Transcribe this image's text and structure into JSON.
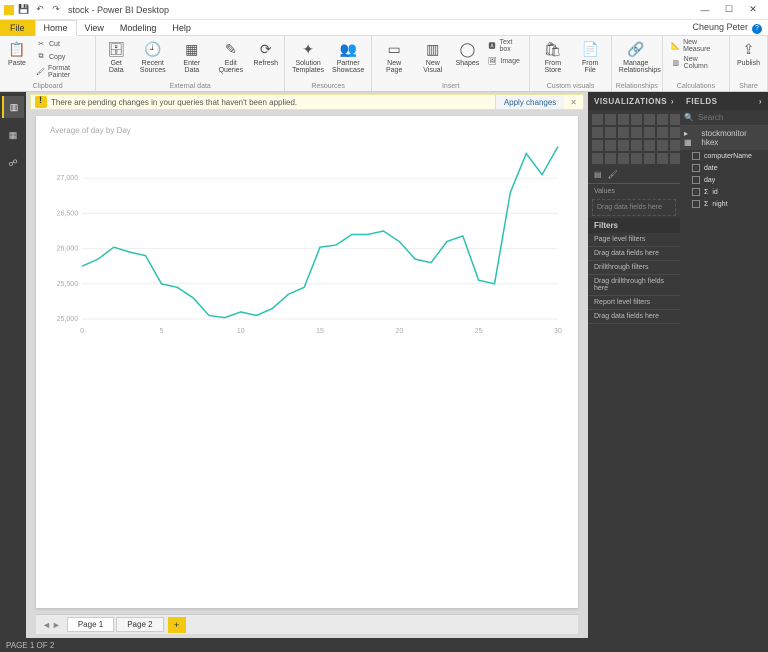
{
  "titlebar": {
    "title": "stock - Power BI Desktop"
  },
  "menu": {
    "file": "File",
    "tabs": [
      "Home",
      "View",
      "Modeling",
      "Help"
    ],
    "active": "Home",
    "user": "Cheung Peter"
  },
  "ribbon": {
    "clipboard": {
      "paste": "Paste",
      "cut": "Cut",
      "copy": "Copy",
      "format": "Format Painter",
      "group": "Clipboard"
    },
    "external": {
      "get": "Get Data",
      "recent": "Recent Sources",
      "enter": "Enter Data",
      "edit": "Edit Queries",
      "refresh": "Refresh",
      "group": "External data"
    },
    "resources": {
      "solution": "Solution Templates",
      "partner": "Partner Showcase",
      "group": "Resources"
    },
    "insert": {
      "newpage": "New Page",
      "newvisual": "New Visual",
      "shapes": "Shapes",
      "textbox": "Text box",
      "image": "Image",
      "group": "Insert"
    },
    "custom": {
      "store": "From Store",
      "file": "From File",
      "group": "Custom visuals"
    },
    "rel": {
      "manage": "Manage Relationships",
      "group": "Relationships"
    },
    "calc": {
      "measure": "New Measure",
      "column": "New Column",
      "group": "Calculations"
    },
    "share": {
      "publish": "Publish",
      "group": "Share"
    }
  },
  "warning": {
    "text": "There are pending changes in your queries that haven't been applied.",
    "apply": "Apply changes"
  },
  "pages": {
    "page1": "Page 1",
    "page2": "Page 2",
    "status": "PAGE 1 OF 2"
  },
  "viz": {
    "header": "Visualizations",
    "values": "Values",
    "drag": "Drag data fields here",
    "filters": "Filters",
    "pagefilters": "Page level filters",
    "dragfilters": "Drag data fields here",
    "drill": "Drillthrough filters",
    "dragdrill": "Drag drillthrough fields here",
    "report": "Report level filters",
    "dragreport": "Drag data fields here"
  },
  "fields": {
    "header": "Fields",
    "search": "Search",
    "table": "stockmonitor hkex",
    "cols": [
      "computerName",
      "date",
      "day",
      "id",
      "night"
    ]
  },
  "chart_data": {
    "type": "line",
    "title": "Average of day by Day",
    "xlabel": "",
    "ylabel": "",
    "ylim": [
      25000,
      27500
    ],
    "yticks": [
      25000,
      25500,
      26000,
      26500,
      27000
    ],
    "x": [
      0,
      1,
      2,
      3,
      4,
      5,
      6,
      7,
      8,
      9,
      10,
      11,
      12,
      13,
      14,
      15,
      16,
      17,
      18,
      19,
      20,
      21,
      22,
      23,
      24,
      25,
      26,
      27,
      28,
      29,
      30
    ],
    "xticks": [
      0,
      5,
      10,
      15,
      20,
      25,
      30
    ],
    "values": [
      25750,
      25850,
      26020,
      25950,
      25900,
      25500,
      25450,
      25300,
      25050,
      25020,
      25100,
      25050,
      25150,
      25350,
      25450,
      26020,
      26050,
      26200,
      26200,
      26250,
      26100,
      25850,
      25800,
      26100,
      26180,
      25550,
      25500,
      26800,
      27350,
      27050,
      27450
    ]
  }
}
